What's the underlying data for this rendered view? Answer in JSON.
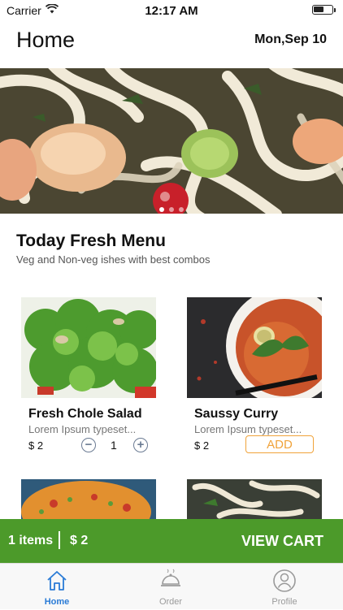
{
  "status_bar": {
    "carrier": "Carrier",
    "time": "12:17 AM"
  },
  "nav": {
    "title": "Home",
    "date": "Mon,Sep 10"
  },
  "hero": {
    "slide_count": 3,
    "active_slide": 1
  },
  "section": {
    "title": "Today Fresh Menu",
    "subtitle": "Veg and Non-veg ishes with best combos"
  },
  "menu": [
    {
      "name": "Fresh Chole Salad",
      "desc": "Lorem Ipsum typeset...",
      "price": "$ 2",
      "qty": "1",
      "qty_minus": "−",
      "qty_plus": "+"
    },
    {
      "name": "Saussy Curry",
      "desc": "Lorem Ipsum typeset...",
      "price": "$ 2",
      "add_label": "ADD"
    }
  ],
  "cart": {
    "items": "1 items",
    "price": "$ 2",
    "action": "VIEW CART"
  },
  "tabs": [
    {
      "label": "Home",
      "icon": "home-icon",
      "active": true
    },
    {
      "label": "Order",
      "icon": "food-tray-icon",
      "active": false
    },
    {
      "label": "Profile",
      "icon": "profile-icon",
      "active": false
    }
  ],
  "colors": {
    "accent_green": "#4c9a2a",
    "add_orange": "#f0a33a",
    "tab_active": "#2a7bd6"
  }
}
